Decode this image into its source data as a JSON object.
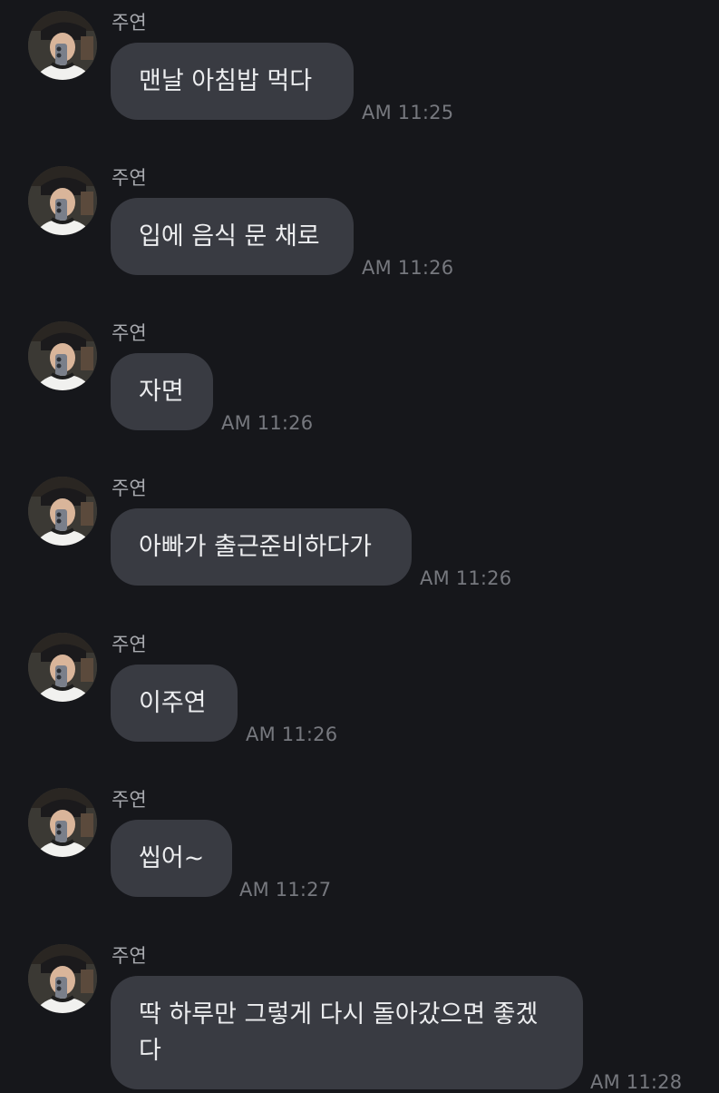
{
  "messages": [
    {
      "sender": "주연",
      "text": "맨날 아침밥 먹다",
      "time": "AM 11:25"
    },
    {
      "sender": "주연",
      "text": "입에 음식 문 채로",
      "time": "AM 11:26"
    },
    {
      "sender": "주연",
      "text": "자면",
      "time": "AM 11:26"
    },
    {
      "sender": "주연",
      "text": "아빠가 출근준비하다가",
      "time": "AM 11:26"
    },
    {
      "sender": "주연",
      "text": "이주연",
      "time": "AM 11:26"
    },
    {
      "sender": "주연",
      "text": "씹어~",
      "time": "AM 11:27"
    },
    {
      "sender": "주연",
      "text": "딱 하루만 그렇게 다시 돌아갔으면 좋겠다",
      "time": "AM 11:28"
    }
  ],
  "avatar_icon": "profile-photo-icon",
  "colors": {
    "background": "#16171b",
    "bubble": "#393b42",
    "text": "#ecedef",
    "sender": "#a9abb0",
    "time": "#76787e"
  }
}
